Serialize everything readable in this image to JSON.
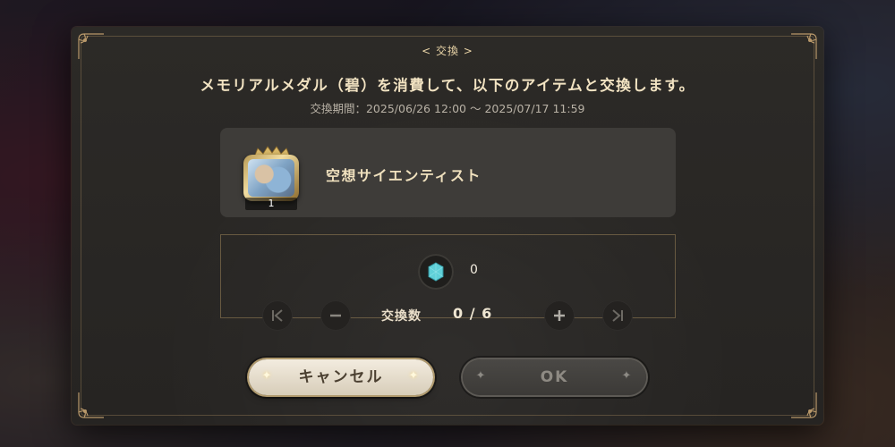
{
  "dialog": {
    "header_tag": "< 交換 >",
    "title": "メモリアルメダル（碧）を消費して、以下のアイテムと交換します。",
    "period": "交換期間：2025/06/26 12:00 ～ 2025/07/17 11:59"
  },
  "item": {
    "name": "空想サイエンティスト",
    "count": "1",
    "icon": "character-card-icon"
  },
  "currency": {
    "icon": "blue-gem-icon",
    "amount": "0",
    "color": "#5fd0d8"
  },
  "quantity": {
    "label": "交換数",
    "value": "0 / 6"
  },
  "buttons": {
    "cancel_label": "キャンセル",
    "ok_label": "OK"
  },
  "colors": {
    "accent_gold": "#e8d3a6",
    "panel": "#2c2a27"
  }
}
